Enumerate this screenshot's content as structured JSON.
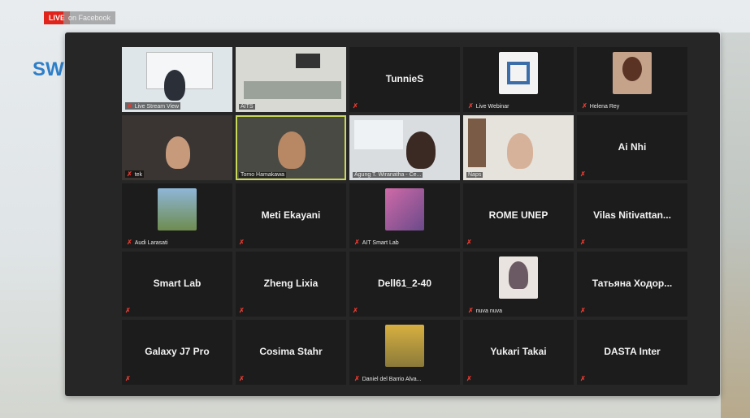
{
  "badges": {
    "live": "LIVE",
    "platform": "on Facebook"
  },
  "side_logo": "SW",
  "tiles": [
    {
      "name": "Live Stream View",
      "type": "video"
    },
    {
      "name": "AITS",
      "type": "video"
    },
    {
      "name": "TunnieS",
      "type": "name"
    },
    {
      "name": "Live Webinar",
      "type": "avatar"
    },
    {
      "name": "Helena Rey",
      "type": "avatar"
    },
    {
      "name": "tek",
      "type": "video"
    },
    {
      "name": "Tomo Hamakawa",
      "type": "video",
      "speaking": true
    },
    {
      "name": "Agung T. Wiranatha - Ce...",
      "type": "video"
    },
    {
      "name": "Naps",
      "type": "video"
    },
    {
      "name": "Ai Nhi",
      "type": "name"
    },
    {
      "name": "Audi Larasati",
      "type": "avatar"
    },
    {
      "name": "Meti Ekayani",
      "type": "name"
    },
    {
      "name": "AIT Smart Lab",
      "type": "avatar"
    },
    {
      "name": "ROME UNEP",
      "type": "name"
    },
    {
      "name": "Vilas  Nitivattan...",
      "type": "name"
    },
    {
      "name": "Smart Lab",
      "type": "name"
    },
    {
      "name": "Zheng Lixia",
      "type": "name"
    },
    {
      "name": "Dell61_2-40",
      "type": "name"
    },
    {
      "name": "nuva nuva",
      "type": "avatar"
    },
    {
      "name": "Татьяна  Ходор...",
      "type": "name"
    },
    {
      "name": "Galaxy J7 Pro",
      "type": "name"
    },
    {
      "name": "Cosima Stahr",
      "type": "name"
    },
    {
      "name": "Daniel del Barrio Alva...",
      "type": "avatar"
    },
    {
      "name": "Yukari Takai",
      "type": "name"
    },
    {
      "name": "DASTA Inter",
      "type": "name"
    }
  ],
  "colors": {
    "live": "#e0241b",
    "mic_muted": "#e53b30",
    "speaking_border": "#c9d95a",
    "tile_bg": "#1c1c1c"
  }
}
